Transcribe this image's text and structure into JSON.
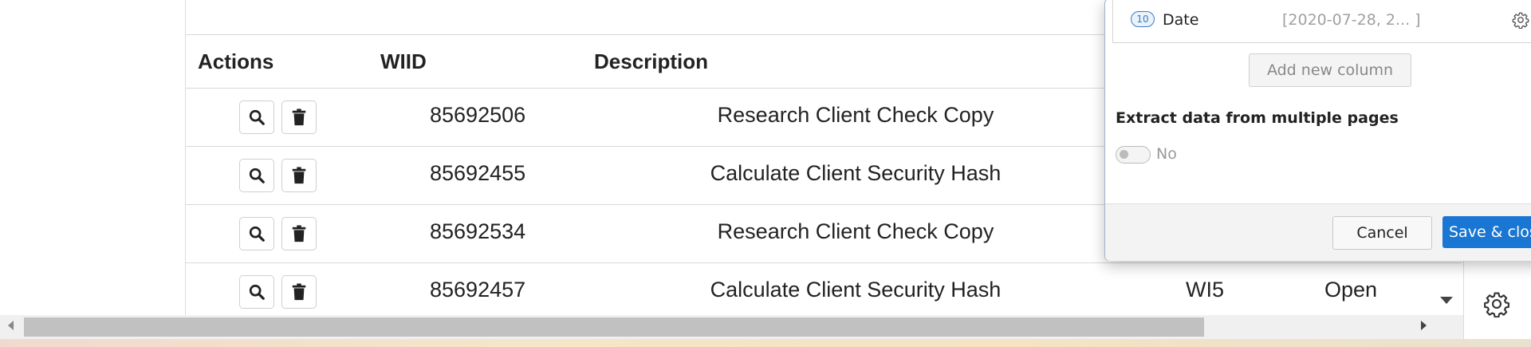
{
  "table": {
    "headers": {
      "actions": "Actions",
      "wiid": "WIID",
      "description": "Description"
    },
    "rows": [
      {
        "wiid": "85692506",
        "description": "Research Client Check Copy"
      },
      {
        "wiid": "85692455",
        "description": "Calculate Client Security Hash"
      },
      {
        "wiid": "85692534",
        "description": "Research Client Check Copy"
      },
      {
        "wiid": "85692457",
        "description": "Calculate Client Security Hash",
        "queue": "WI5",
        "status": "Open"
      }
    ]
  },
  "panel": {
    "column_number": "10",
    "column_label": "Date",
    "column_value": "[2020-07-28, 2... ]",
    "add_column_label": "Add new column",
    "extract_label": "Extract data from multiple pages",
    "toggle_label": "No",
    "cancel_label": "Cancel",
    "save_label": "Save & close"
  },
  "icons": {
    "search": "search-icon",
    "delete": "trash-icon",
    "settings": "gear-icon",
    "caret": "chevron-down-icon"
  },
  "colors": {
    "primary": "#1976d2",
    "badge": "#3b7dc4"
  }
}
